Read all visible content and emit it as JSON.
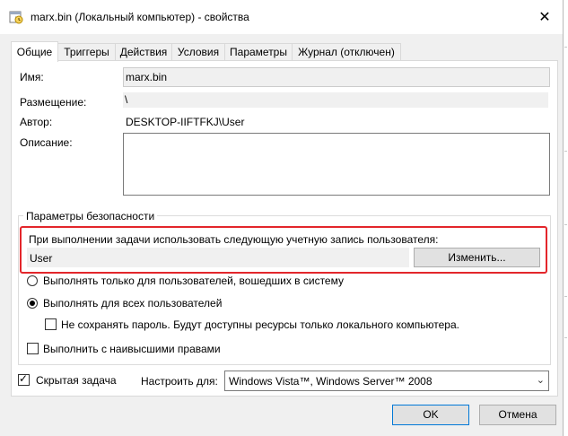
{
  "window": {
    "title": "marx.bin (Локальный компьютер) - свойства",
    "close_icon": "close-icon"
  },
  "tabs": [
    {
      "label": "Общие",
      "active": true
    },
    {
      "label": "Триггеры"
    },
    {
      "label": "Действия"
    },
    {
      "label": "Условия"
    },
    {
      "label": "Параметры"
    },
    {
      "label": "Журнал (отключен)"
    }
  ],
  "general": {
    "name_label": "Имя:",
    "name_value": "marx.bin",
    "location_label": "Размещение:",
    "location_value": "\\",
    "author_label": "Автор:",
    "author_value": "DESKTOP-IIFTFKJ\\User",
    "description_label": "Описание:",
    "description_value": ""
  },
  "security": {
    "group_title": "Параметры безопасности",
    "account_prompt": "При выполнении задачи использовать следующую учетную запись пользователя:",
    "account_value": "User",
    "change_button": "Изменить...",
    "radio_logged_on": "Выполнять только для пользователей, вошедших в систему",
    "radio_all_users": "Выполнять для всех пользователей",
    "selected_radio": "all_users",
    "no_store_password": "Не сохранять пароль. Будут доступны ресурсы только локального компьютера.",
    "no_store_password_checked": false,
    "highest_privileges": "Выполнить с наивысшими правами",
    "highest_privileges_checked": false
  },
  "bottom": {
    "hidden_task": "Скрытая задача",
    "hidden_task_checked": true,
    "configure_label": "Настроить для:",
    "configure_value": "Windows Vista™, Windows Server™ 2008",
    "ok_button": "OK",
    "cancel_button": "Отмена"
  },
  "colors": {
    "highlight": "#e3262b",
    "focus": "#0078d7"
  }
}
